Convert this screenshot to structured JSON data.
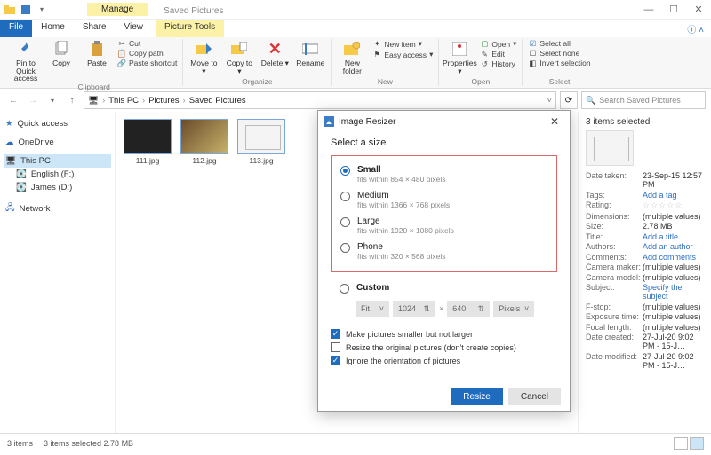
{
  "window": {
    "context_tab": "Manage",
    "title": "Saved Pictures",
    "tabs": {
      "file": "File",
      "home": "Home",
      "share": "Share",
      "view": "View",
      "picture_tools": "Picture Tools"
    }
  },
  "ribbon": {
    "clipboard": {
      "pin": "Pin to Quick access",
      "copy": "Copy",
      "paste": "Paste",
      "cut": "Cut",
      "copy_path": "Copy path",
      "paste_shortcut": "Paste shortcut",
      "label": "Clipboard"
    },
    "organize": {
      "move": "Move to",
      "copy": "Copy to",
      "delete": "Delete",
      "rename": "Rename",
      "label": "Organize"
    },
    "new": {
      "folder": "New folder",
      "new_item": "New item",
      "easy_access": "Easy access",
      "label": "New"
    },
    "open": {
      "properties": "Properties",
      "open": "Open",
      "edit": "Edit",
      "history": "History",
      "label": "Open"
    },
    "select": {
      "all": "Select all",
      "none": "Select none",
      "invert": "Invert selection",
      "label": "Select"
    }
  },
  "breadcrumb": {
    "pc": "This PC",
    "pics": "Pictures",
    "saved": "Saved Pictures"
  },
  "search": {
    "placeholder": "Search Saved Pictures"
  },
  "nav": {
    "quick": "Quick access",
    "onedrive": "OneDrive",
    "thispc": "This PC",
    "english": "English (F:)",
    "james": "James (D:)",
    "network": "Network"
  },
  "files": {
    "f1": "111.jpg",
    "f2": "112.jpg",
    "f3": "113.jpg"
  },
  "details": {
    "header": "3 items selected",
    "rows": {
      "date_taken_k": "Date taken:",
      "date_taken_v": "23-Sep-15 12:57 PM",
      "tags_k": "Tags:",
      "tags_v": "Add a tag",
      "rating_k": "Rating:",
      "dimensions_k": "Dimensions:",
      "dimensions_v": "(multiple values)",
      "size_k": "Size:",
      "size_v": "2.78 MB",
      "title_k": "Title:",
      "title_v": "Add a title",
      "authors_k": "Authors:",
      "authors_v": "Add an author",
      "comments_k": "Comments:",
      "comments_v": "Add comments",
      "cam_maker_k": "Camera maker:",
      "cam_maker_v": "(multiple values)",
      "cam_model_k": "Camera model:",
      "cam_model_v": "(multiple values)",
      "subject_k": "Subject:",
      "subject_v": "Specify the subject",
      "fstop_k": "F-stop:",
      "fstop_v": "(multiple values)",
      "exposure_k": "Exposure time:",
      "exposure_v": "(multiple values)",
      "focal_k": "Focal length:",
      "focal_v": "(multiple values)",
      "created_k": "Date created:",
      "created_v": "27-Jul-20 9:02 PM - 15-J…",
      "modified_k": "Date modified:",
      "modified_v": "27-Jul-20 9:02 PM - 15-J…"
    }
  },
  "status": {
    "items": "3 items",
    "selected": "3 items selected 2.78 MB"
  },
  "dialog": {
    "title": "Image Resizer",
    "heading": "Select a size",
    "options": {
      "small_n": "Small",
      "small_d": "fits within 854 × 480 pixels",
      "medium_n": "Medium",
      "medium_d": "fits within 1366 × 768 pixels",
      "large_n": "Large",
      "large_d": "fits within 1920 × 1080 pixels",
      "phone_n": "Phone",
      "phone_d": "fits within 320 × 568 pixels",
      "custom_n": "Custom"
    },
    "custom": {
      "fit": "Fit",
      "w": "1024",
      "h": "640",
      "unit": "Pixels"
    },
    "checks": {
      "smaller": "Make pictures smaller but not larger",
      "nocopy": "Resize the original pictures (don't create copies)",
      "orient": "Ignore the orientation of pictures"
    },
    "buttons": {
      "resize": "Resize",
      "cancel": "Cancel"
    }
  }
}
